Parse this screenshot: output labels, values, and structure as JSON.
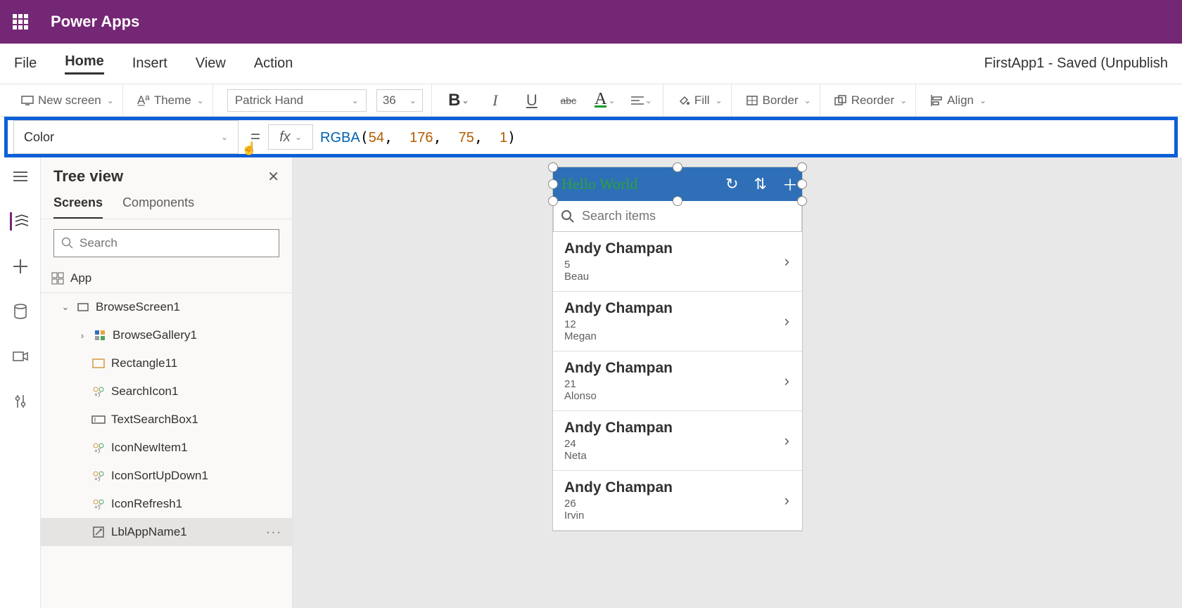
{
  "brand": "Power Apps",
  "menu": {
    "items": [
      "File",
      "Home",
      "Insert",
      "View",
      "Action"
    ],
    "active": "Home",
    "status": "FirstApp1 - Saved (Unpublish"
  },
  "ribbon": {
    "newscreen": "New screen",
    "theme": "Theme",
    "font": "Patrick Hand",
    "size": "36",
    "fill": "Fill",
    "border": "Border",
    "reorder": "Reorder",
    "align": "Align"
  },
  "formula": {
    "property": "Color",
    "fn": "RGBA",
    "args": [
      "54",
      "176",
      "75",
      "1"
    ]
  },
  "tree": {
    "title": "Tree view",
    "tabs": [
      "Screens",
      "Components"
    ],
    "activeTab": "Screens",
    "searchPlaceholder": "Search",
    "nodes": {
      "app": "App",
      "browseScreen": "BrowseScreen1",
      "gallery": "BrowseGallery1",
      "items": [
        "Rectangle11",
        "SearchIcon1",
        "TextSearchBox1",
        "IconNewItem1",
        "IconSortUpDown1",
        "IconRefresh1",
        "LblAppName1"
      ]
    }
  },
  "preview": {
    "title": "Hello World",
    "searchPlaceholder": "Search items",
    "rows": [
      {
        "name": "Andy Champan",
        "num": "5",
        "sub": "Beau"
      },
      {
        "name": "Andy Champan",
        "num": "12",
        "sub": "Megan"
      },
      {
        "name": "Andy Champan",
        "num": "21",
        "sub": "Alonso"
      },
      {
        "name": "Andy Champan",
        "num": "24",
        "sub": "Neta"
      },
      {
        "name": "Andy Champan",
        "num": "26",
        "sub": "Irvin"
      }
    ]
  }
}
